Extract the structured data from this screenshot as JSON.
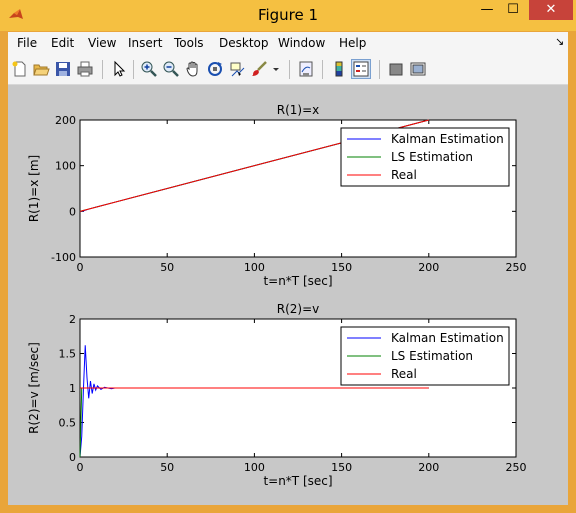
{
  "window": {
    "title": "Figure 1",
    "minimize_glyph": "—",
    "maximize_glyph": "☐",
    "close_glyph": "✕"
  },
  "menu": {
    "items": [
      "File",
      "Edit",
      "View",
      "Insert",
      "Tools",
      "Desktop",
      "Window",
      "Help"
    ],
    "dock_glyph": "↘"
  },
  "toolbar": {
    "icons": [
      "new-figure-icon",
      "open-file-icon",
      "save-icon",
      "print-icon",
      "pointer-icon",
      "zoom-in-icon",
      "zoom-out-icon",
      "pan-hand-icon",
      "rotate-3d-icon",
      "data-cursor-icon",
      "brush-icon",
      "brush-dropdown-icon",
      "link-plot-icon",
      "insert-colorbar-icon",
      "insert-legend-icon",
      "hide-plot-tools-icon",
      "show-plot-tools-icon"
    ]
  },
  "colors": {
    "kalman": "#0000ff",
    "ls": "#008000",
    "real": "#ff0000"
  },
  "chart_data": [
    {
      "type": "line",
      "title": "R(1)=x",
      "xlabel": "t=n*T [sec]",
      "ylabel": "R(1)=x [m]",
      "xlim": [
        0,
        250
      ],
      "ylim": [
        -100,
        200
      ],
      "xticks": [
        0,
        50,
        100,
        150,
        200,
        250
      ],
      "yticks": [
        -100,
        0,
        100,
        200
      ],
      "legend": "top-right",
      "grid": false,
      "series": [
        {
          "name": "Kalman Estimation",
          "x": [
            0,
            2,
            5,
            10,
            20,
            50,
            100,
            150,
            200
          ],
          "y": [
            0,
            1,
            5,
            10,
            20,
            50,
            100,
            150,
            200
          ]
        },
        {
          "name": "LS Estimation",
          "x": [
            0,
            2,
            5,
            10,
            20,
            50,
            100,
            150,
            200
          ],
          "y": [
            0,
            2,
            5,
            10,
            20,
            50,
            100,
            150,
            200
          ]
        },
        {
          "name": "Real",
          "x": [
            0,
            200
          ],
          "y": [
            0,
            200
          ]
        }
      ]
    },
    {
      "type": "line",
      "title": "R(2)=v",
      "xlabel": "t=n*T [sec]",
      "ylabel": "R(2)=v [m/sec]",
      "xlim": [
        0,
        250
      ],
      "ylim": [
        0,
        2
      ],
      "xticks": [
        0,
        50,
        100,
        150,
        200,
        250
      ],
      "yticks": [
        0,
        0.5,
        1,
        1.5,
        2
      ],
      "legend": "top-right",
      "grid": false,
      "series": [
        {
          "name": "Kalman Estimation",
          "x": [
            0,
            1,
            2,
            3,
            4,
            5,
            6,
            7,
            8,
            9,
            10,
            12,
            14,
            16,
            18,
            20,
            25,
            30,
            200
          ],
          "y": [
            0,
            0.3,
            1.0,
            1.62,
            1.15,
            0.85,
            1.1,
            0.92,
            1.06,
            0.97,
            1.03,
            0.98,
            1.01,
            1.0,
            0.99,
            1.0,
            1.0,
            1.0,
            1.0
          ]
        },
        {
          "name": "LS Estimation",
          "x": [
            0,
            1,
            2,
            3,
            4,
            200
          ],
          "y": [
            0,
            1.0,
            1.0,
            1.0,
            1.0,
            1.0
          ]
        },
        {
          "name": "Real",
          "x": [
            0,
            200
          ],
          "y": [
            1,
            1
          ]
        }
      ]
    }
  ]
}
